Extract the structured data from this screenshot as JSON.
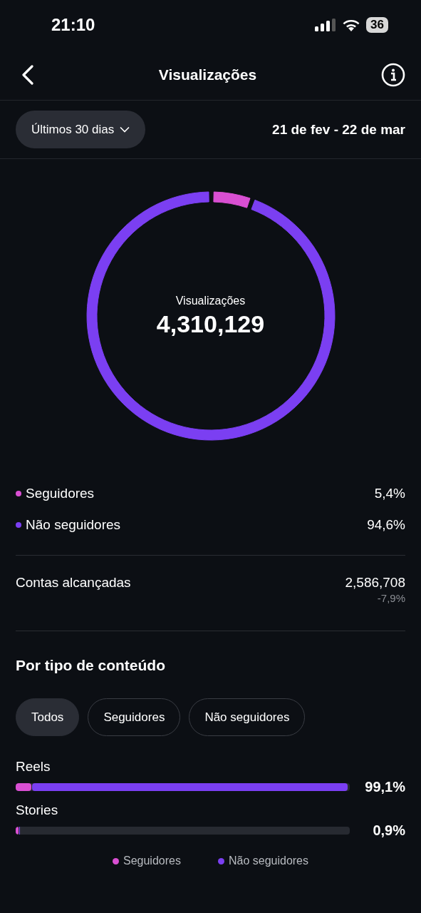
{
  "status_bar": {
    "time": "21:10",
    "battery": "36"
  },
  "header": {
    "title": "Visualizações"
  },
  "filter": {
    "period": "Últimos 30 dias",
    "date_range": "21 de fev - 22 de mar"
  },
  "summary": {
    "label": "Visualizações",
    "total": "4,310,129",
    "chart_data": {
      "type": "donut",
      "values": [
        5.4,
        94.6
      ]
    }
  },
  "breakdown": [
    {
      "label": "Seguidores",
      "value": "5,4%",
      "color": "#d94fd2"
    },
    {
      "label": "Não seguidores",
      "value": "94,6%",
      "color": "#7b3ff2"
    }
  ],
  "reach": {
    "label": "Contas alcançadas",
    "value": "2,586,708",
    "change": "-7,9%"
  },
  "content_type": {
    "heading": "Por tipo de conteúdo",
    "chips": [
      {
        "label": "Todos",
        "selected": true
      },
      {
        "label": "Seguidores",
        "selected": false
      },
      {
        "label": "Não seguidores",
        "selected": false
      }
    ],
    "rows": [
      {
        "label": "Reels",
        "value": "99,1%",
        "segments": [
          {
            "color": "#d94fd2",
            "level": 0.047
          },
          {
            "color": "#7b3ff2",
            "level": 0.945
          }
        ]
      },
      {
        "label": "Stories",
        "value": "0,9%",
        "segments": [
          {
            "color": "#d94fd2",
            "level": 0.008
          },
          {
            "color": "#7b3ff2",
            "level": 0.002
          }
        ]
      }
    ],
    "legend": [
      {
        "label": "Seguidores",
        "color": "#d94fd2"
      },
      {
        "label": "Não seguidores",
        "color": "#7b3ff2"
      }
    ]
  }
}
